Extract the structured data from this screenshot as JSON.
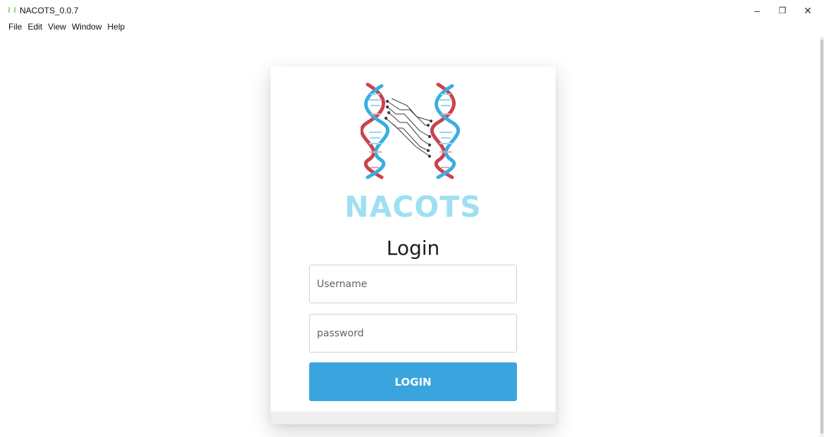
{
  "window": {
    "title": "NACOTS_0.0.7",
    "minimize_glyph": "–",
    "maximize_glyph": "❐",
    "close_glyph": "✕"
  },
  "menu": {
    "items": [
      "File",
      "Edit",
      "View",
      "Window",
      "Help"
    ]
  },
  "login_card": {
    "brand": "NACOTS",
    "heading": "Login",
    "username_placeholder": "Username",
    "password_placeholder": "password",
    "button_label": "LOGIN"
  },
  "colors": {
    "brand_text": "#9ee0f2",
    "button": "#3aa4de",
    "dna_red": "#c9434e",
    "dna_blue": "#3aaee0"
  },
  "icons": {
    "app": "app-icon",
    "logo": "dna-circuit-logo",
    "minimize": "minimize-icon",
    "maximize": "restore-icon",
    "close": "close-icon"
  }
}
